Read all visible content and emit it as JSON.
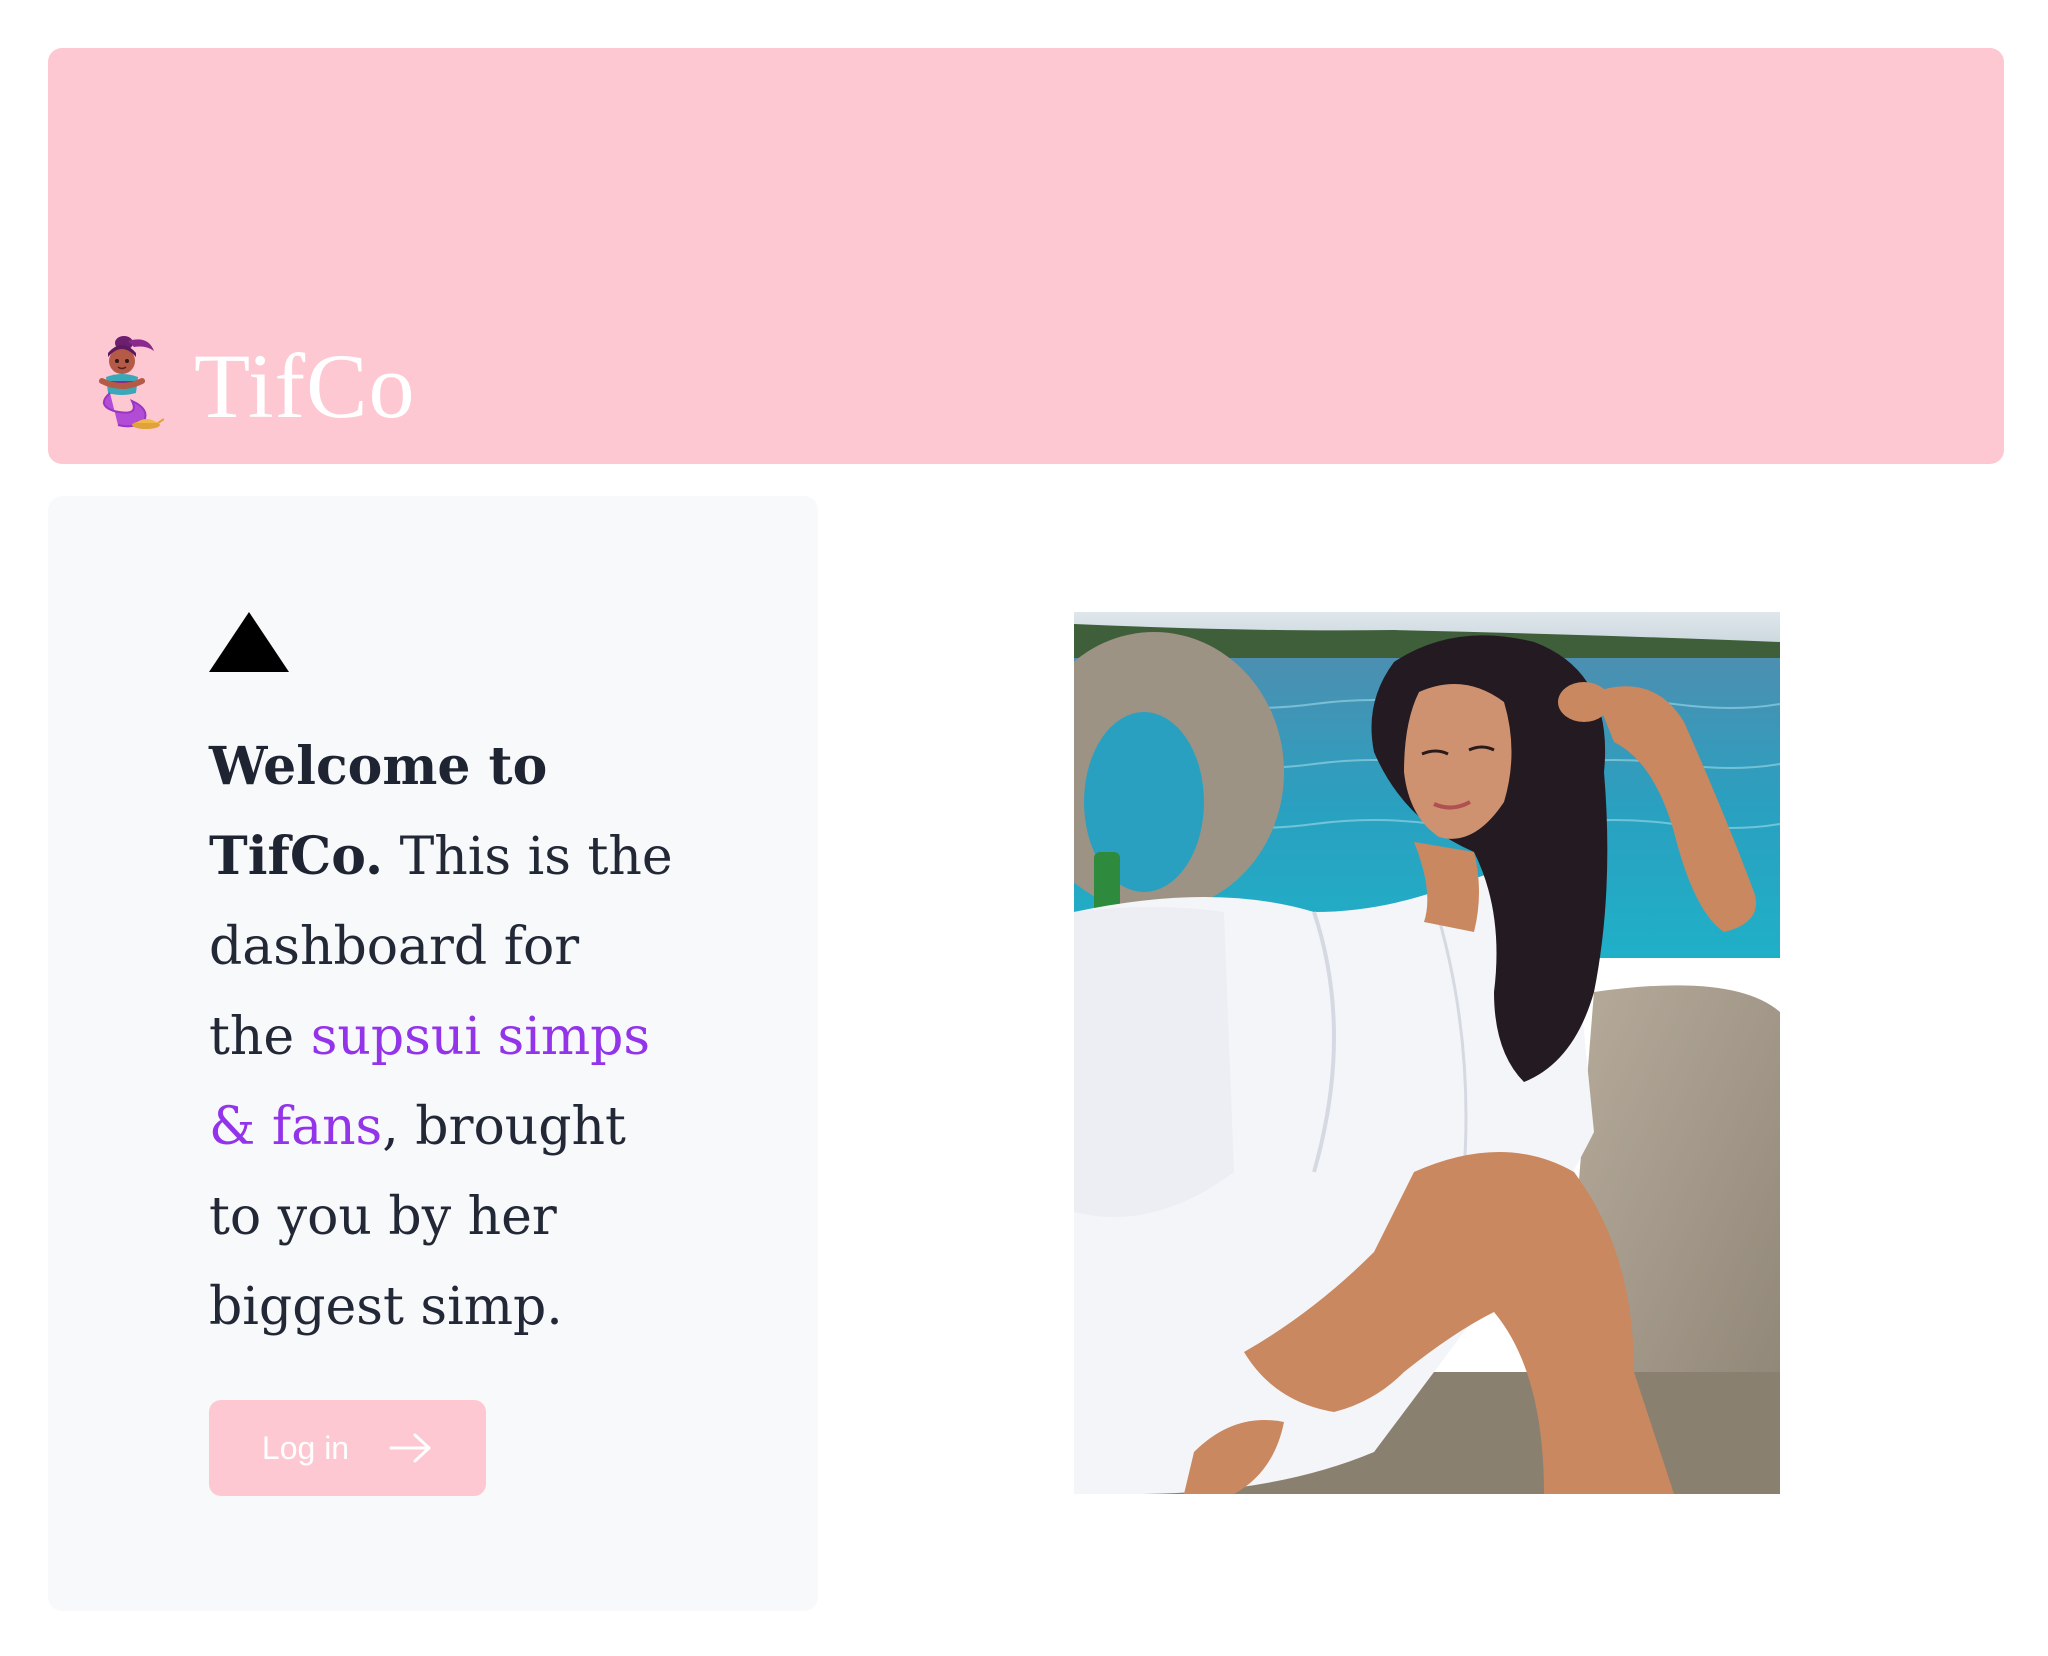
{
  "header": {
    "brand_name": "TifCo",
    "logo_icon": "genie-icon"
  },
  "welcome": {
    "mark_icon": "triangle-icon",
    "bold_text": "Welcome to TifCo.",
    "text_1": " This is the dashboard for the ",
    "highlight_text": "supsui simps & fans",
    "text_2": ", brought to you by her biggest simp.",
    "highlight_color": "#9333ea",
    "login_label": "Log in",
    "login_icon": "arrow-right-icon"
  },
  "photo": {
    "subject": "woman-on-boat-photo"
  },
  "colors": {
    "brand_pink": "#fdc8d2",
    "card_bg": "#f8f9fb",
    "text_dark": "#232836"
  }
}
